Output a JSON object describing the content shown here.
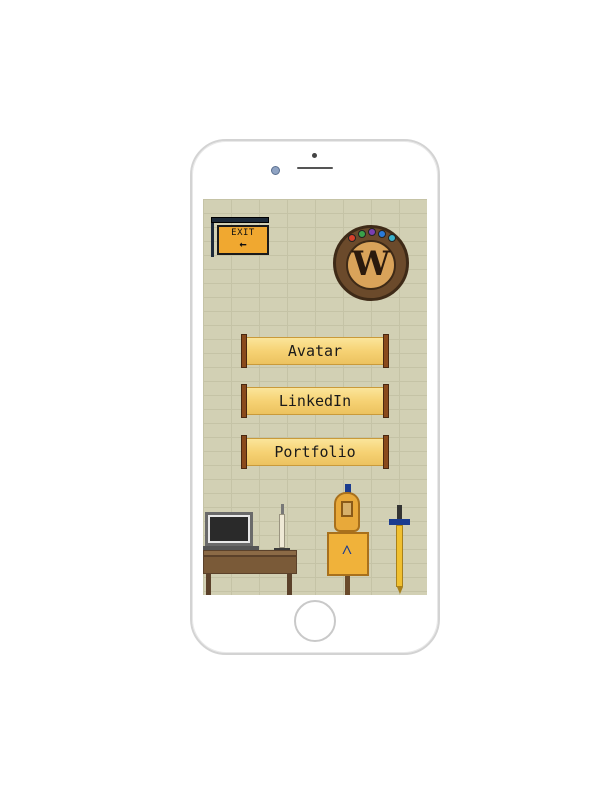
{
  "app": {
    "logo_letter": "W",
    "logo_gem_colors": [
      "#d8402a",
      "#3aa14a",
      "#7a3fb0",
      "#2a7ad8",
      "#3ab0c8"
    ]
  },
  "exit_sign": {
    "label": "EXIT",
    "arrow_icon": "left-arrow-icon",
    "arrow_glyph": "←"
  },
  "menu": {
    "buttons": [
      {
        "label": "Avatar"
      },
      {
        "label": "LinkedIn"
      },
      {
        "label": "Portfolio"
      }
    ]
  },
  "scene": {
    "props": [
      "laptop",
      "desk",
      "candle",
      "suit-of-armor",
      "sword"
    ]
  },
  "colors": {
    "wall": "#d2d0b4",
    "scroll_paper": "#f6d274",
    "scroll_rod": "#8a4a1c",
    "exit_board": "#f0a830"
  }
}
